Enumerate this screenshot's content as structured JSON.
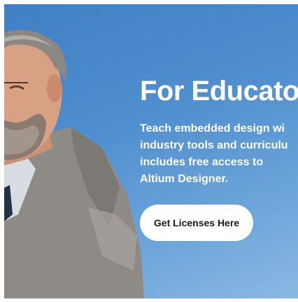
{
  "hero": {
    "title": "For Educato",
    "description_lines": [
      "Teach embedded design wi",
      "industry tools and curriculu",
      "includes free access to",
      "Altium Designer."
    ],
    "cta_label": "Get Licenses Here"
  },
  "colors": {
    "background_top": "#3f7fc4",
    "background_bottom": "#8bb8e3",
    "text": "#ffffff",
    "button_bg": "#ffffff",
    "button_text": "#1a1a1a"
  }
}
